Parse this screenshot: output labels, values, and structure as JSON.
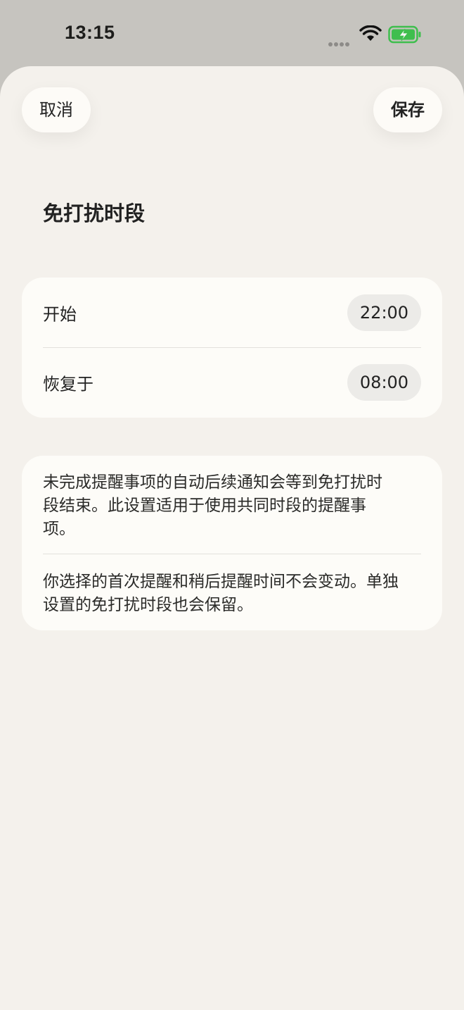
{
  "status_bar": {
    "time": "13:15",
    "wifi_icon": "wifi-icon",
    "battery_icon": "battery-charging-icon",
    "battery_color": "#3fbe4e"
  },
  "toolbar": {
    "cancel_label": "取消",
    "save_label": "保存"
  },
  "page": {
    "title": "免打扰时段"
  },
  "schedule": {
    "start_label": "开始",
    "start_time": "22:00",
    "resume_label": "恢复于",
    "resume_time": "08:00"
  },
  "info": {
    "paragraph1": "未完成提醒事项的自动后续通知会等到免打扰时段结束。此设置适用于使用共同时段的提醒事项。",
    "paragraph2": "你选择的首次提醒和稍后提醒时间不会变动。单独设置的免打扰时段也会保留。"
  }
}
